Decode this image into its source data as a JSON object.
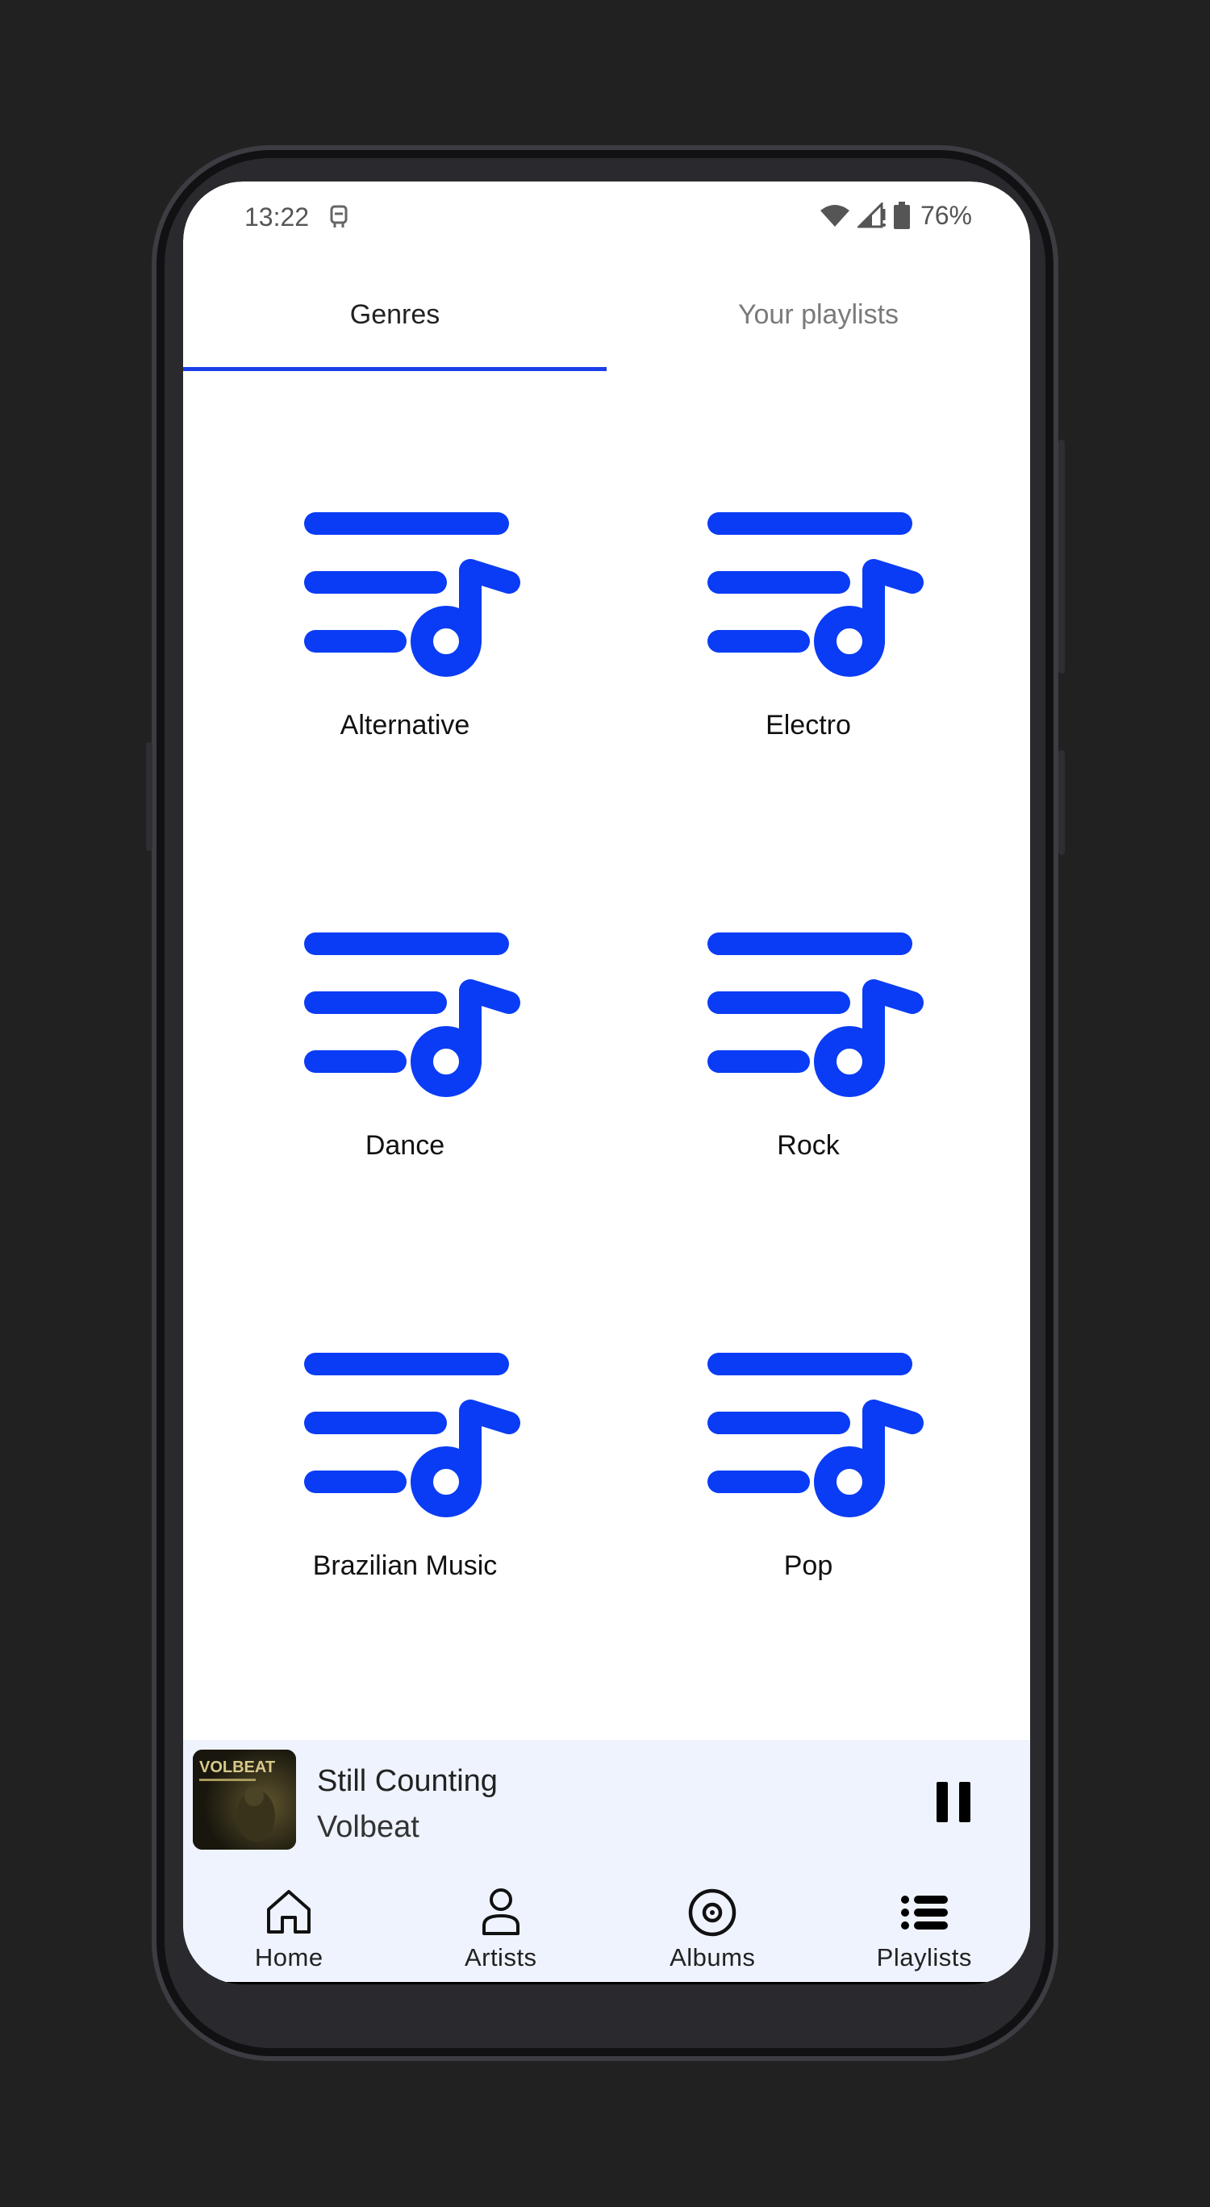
{
  "status_bar": {
    "time": "13:22",
    "battery": "76%"
  },
  "tabs": [
    {
      "label": "Genres",
      "active": true
    },
    {
      "label": "Your playlists",
      "active": false
    }
  ],
  "genres": [
    {
      "label": "Alternative"
    },
    {
      "label": "Electro"
    },
    {
      "label": "Dance"
    },
    {
      "label": "Rock"
    },
    {
      "label": "Brazilian Music"
    },
    {
      "label": "Pop"
    }
  ],
  "now_playing": {
    "title": "Still Counting",
    "artist": "Volbeat",
    "album_art_text": "VOLBEAT"
  },
  "bottom_nav": [
    {
      "label": "Home",
      "icon": "home-icon"
    },
    {
      "label": "Artists",
      "icon": "person-icon"
    },
    {
      "label": "Albums",
      "icon": "album-icon"
    },
    {
      "label": "Playlists",
      "icon": "playlist-icon"
    }
  ],
  "colors": {
    "accent": "#1a3ee8",
    "icon_blue": "#0a3cf5",
    "player_bg": "#eef3fd"
  }
}
